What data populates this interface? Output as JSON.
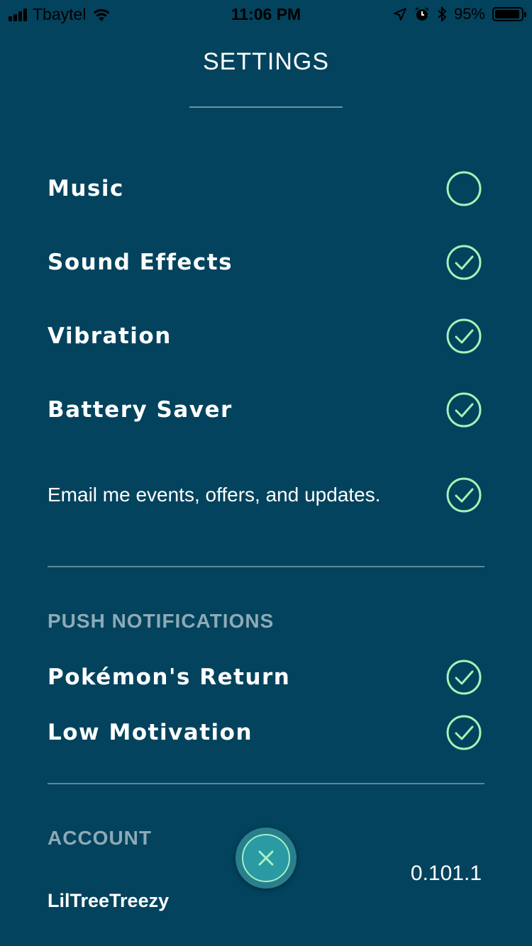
{
  "status_bar": {
    "carrier": "Tbaytel",
    "time": "11:06 PM",
    "battery_text": "95%",
    "battery_level": 0.95,
    "icons": [
      "signal-icon",
      "wifi-icon",
      "location-icon",
      "alarm-icon",
      "bluetooth-icon",
      "battery-icon"
    ]
  },
  "header": {
    "title": "SETTINGS"
  },
  "settings": [
    {
      "label": "Music",
      "checked": false
    },
    {
      "label": "Sound Effects",
      "checked": true
    },
    {
      "label": "Vibration",
      "checked": true
    },
    {
      "label": "Battery Saver",
      "checked": true
    },
    {
      "label": "Email me events, offers, and updates.",
      "checked": true
    }
  ],
  "push_notifications": {
    "header": "PUSH NOTIFICATIONS",
    "items": [
      {
        "label": "Pokémon's Return",
        "checked": true
      },
      {
        "label": "Low Motivation",
        "checked": true
      }
    ]
  },
  "account": {
    "header": "ACCOUNT",
    "username": "LilTreeTreezy",
    "version": "0.101.1"
  },
  "colors": {
    "background": "#03435d",
    "accent": "#a5f2b6",
    "muted": "#8eaab6"
  },
  "close_button": {
    "icon": "close-icon"
  }
}
